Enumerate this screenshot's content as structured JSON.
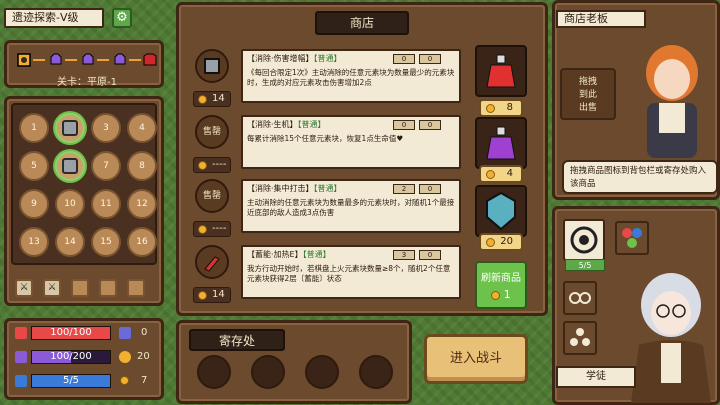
{
  "zone": {
    "title": "遗迹探索-V级",
    "settings_icon": "gear-icon"
  },
  "level": {
    "label": "关卡：平原-1"
  },
  "grid": {
    "cells": [
      "1",
      "2",
      "3",
      "4",
      "5",
      "6",
      "7",
      "8",
      "9",
      "10",
      "11",
      "12",
      "13",
      "14",
      "15",
      "16"
    ],
    "active_cells": [
      2,
      6
    ]
  },
  "stats": {
    "hp": "100/100",
    "mp": "100/200",
    "energy": "5/5",
    "shield": "0",
    "attack": "20",
    "gold": "7",
    "colors": {
      "hp": "#e84848",
      "mp": "#8b5ad9",
      "energy": "#3a7ad9"
    }
  },
  "shop": {
    "title": "商店",
    "items": [
      {
        "icon_label": "",
        "status": "14",
        "head": "【消除·伤害增幅】",
        "quality": "【普通】",
        "desc": "《每回合限定1次》主动消除的任意元素块为数量最少的元素块时，生成的对应元素攻击伤害增加2点",
        "chip_a": "0",
        "chip_b": "0"
      },
      {
        "icon_label": "售罄",
        "status": "----",
        "head": "【消除·生机】",
        "quality": "【普通】",
        "desc": "每累计消除15个任意元素块，恢复1点生命值♥",
        "chip_a": "0",
        "chip_b": "0"
      },
      {
        "icon_label": "售罄",
        "status": "----",
        "head": "【消除·集中打击】",
        "quality": "【普通】",
        "desc": "主动消除的任意元素块为数量最多的元素块时，对随机1个最接近底部的敌人造成3点伤害",
        "chip_a": "2",
        "chip_b": "0"
      },
      {
        "icon_label": "",
        "status": "14",
        "head": "【蓄能·加热E】",
        "quality": "【普通】",
        "desc": "我方行动开始时，若棋盘上火元素块数量≥8个，随机2个任意元素块获得2层〔蓄能〕状态",
        "chip_a": "3",
        "chip_b": "0"
      }
    ],
    "potions": [
      {
        "name": "red-potion-icon",
        "price": "8"
      },
      {
        "name": "purple-potion-icon",
        "price": "4"
      },
      {
        "name": "shield-gem-icon",
        "price": "20"
      }
    ],
    "refresh": {
      "label": "刷新商品",
      "cost": "1"
    }
  },
  "storage": {
    "title": "寄存处"
  },
  "battle": {
    "label": "进入战斗"
  },
  "owner": {
    "title": "商店老板",
    "drag_sell": "拖拽\n到此\n出售",
    "speech": "拖拽商品图标到背包栏或寄存处购入该商品"
  },
  "bag": {
    "badge": "5/5",
    "apprentice": "学徒"
  }
}
